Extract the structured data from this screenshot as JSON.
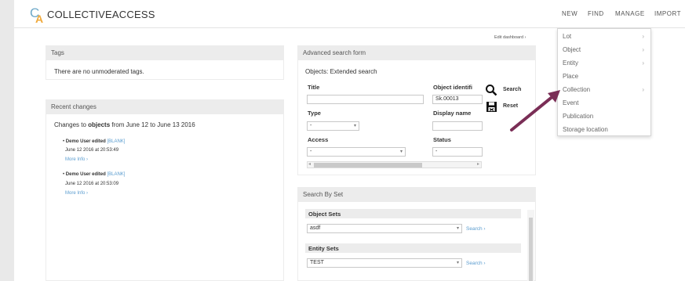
{
  "brand": {
    "logo_c": "C",
    "logo_a": "A",
    "name": "COLLECTIVEACCESS"
  },
  "nav": {
    "new": "NEW",
    "find": "FIND",
    "manage": "MANAGE",
    "import": "IMPORT"
  },
  "dashboard": {
    "edit_link": "Edit dashboard ›"
  },
  "tags": {
    "title": "Tags",
    "text": "There are no unmoderated tags."
  },
  "recent": {
    "title": "Recent changes",
    "intro_pre": "Changes to ",
    "intro_bold": "objects",
    "intro_post": " from June 12 to June 13 2016",
    "entries": [
      {
        "user": "Demo User edited ",
        "item": "[BLANK]",
        "date": "June 12 2016 at 20:53:49",
        "more": "More Info ›"
      },
      {
        "user": "Demo User edited ",
        "item": "[BLANK]",
        "date": "June 12 2016 at 20:53:09",
        "more": "More Info ›"
      }
    ]
  },
  "advsearch": {
    "title": "Advanced search form",
    "form_name": "Objects: Extended search",
    "title_label": "Title",
    "title_value": "",
    "identifier_label": "Object identifi",
    "identifier_value": "Sk.00013",
    "type_label": "Type",
    "type_value": "-",
    "display_label": "Display name",
    "display_value": "",
    "access_label": "Access",
    "access_value": "-",
    "status_label": "Status",
    "status_value": "-",
    "search_btn": "Search",
    "reset_btn": "Reset",
    "icons": {
      "search": "search-icon",
      "reset": "reset-icon"
    }
  },
  "searchbyset": {
    "title": "Search By Set",
    "object_sets_label": "Object Sets",
    "object_set_value": "asdf",
    "entity_sets_label": "Entity Sets",
    "entity_set_value": "TEST",
    "search_link": "Search ›"
  },
  "dropdown": {
    "items": [
      {
        "label": "Lot",
        "has_submenu": true
      },
      {
        "label": "Object",
        "has_submenu": true
      },
      {
        "label": "Entity",
        "has_submenu": true
      },
      {
        "label": "Place",
        "has_submenu": false
      },
      {
        "label": "Collection",
        "has_submenu": true
      },
      {
        "label": "Event",
        "has_submenu": false
      },
      {
        "label": "Publication",
        "has_submenu": false
      },
      {
        "label": "Storage location",
        "has_submenu": false
      }
    ],
    "chevron": "›"
  },
  "colors": {
    "accent_blue": "#5a9ccf",
    "arrow": "#7a2e56",
    "panel_header": "#ececec"
  }
}
